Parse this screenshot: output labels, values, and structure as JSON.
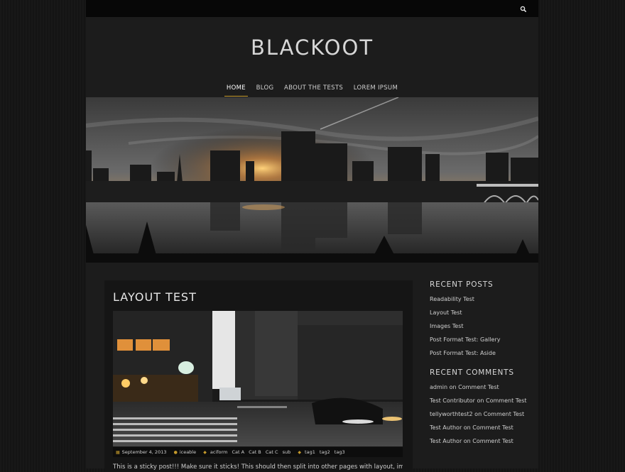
{
  "site": {
    "title": "BLACKOOT"
  },
  "nav": {
    "items": [
      {
        "label": "HOME",
        "active": true
      },
      {
        "label": "BLOG"
      },
      {
        "label": "ABOUT THE TESTS"
      },
      {
        "label": "LOREM IPSUM"
      }
    ]
  },
  "icons": {
    "search": "search-icon",
    "date": "calendar-icon",
    "author": "user-icon",
    "category": "tag-icon",
    "tags": "tags-icon"
  },
  "colors": {
    "accent": "#c59a2b",
    "background": "#151515",
    "panel": "#1c1c1c",
    "topbar": "#070707"
  },
  "post": {
    "title": "LAYOUT TEST",
    "meta": {
      "date": "September 4, 2013",
      "author": "iceable",
      "categories": [
        "aciform",
        "Cat A",
        "Cat B",
        "Cat C",
        "sub"
      ],
      "tags": [
        "tag1",
        "tag2",
        "tag3"
      ]
    },
    "excerpt": "This is a sticky post!!! Make sure it sticks! This should then split into other pages with layout, images,"
  },
  "sidebar": {
    "recent_posts": {
      "title": "RECENT POSTS",
      "items": [
        "Readability Test",
        "Layout Test",
        "Images Test",
        "Post Format Test: Gallery",
        "Post Format Test: Aside"
      ]
    },
    "recent_comments": {
      "title": "RECENT COMMENTS",
      "items": [
        {
          "author": "admin",
          "sep": "on",
          "post": "Comment Test"
        },
        {
          "author": "Test Contributor",
          "sep": "on",
          "post": "Comment Test"
        },
        {
          "author": "tellyworthtest2",
          "sep": "on",
          "post": "Comment Test"
        },
        {
          "author": "Test Author",
          "sep": "on",
          "post": "Comment Test"
        },
        {
          "author": "Test Author",
          "sep": "on",
          "post": "Comment Test"
        }
      ]
    }
  }
}
